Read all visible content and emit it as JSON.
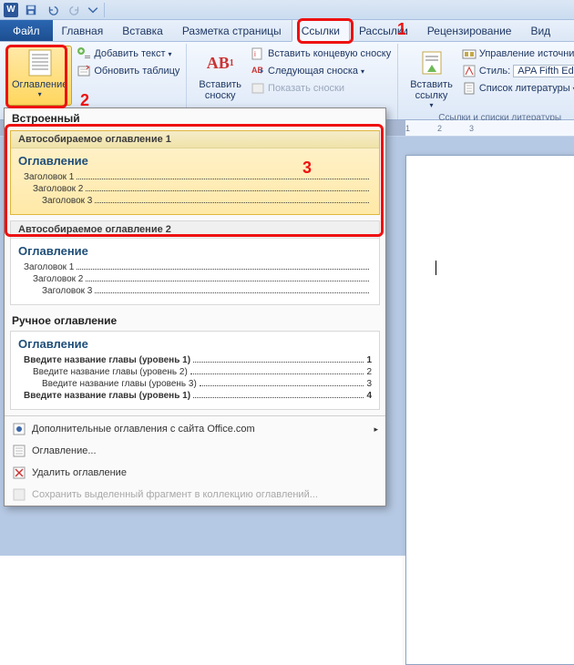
{
  "titlebar": {
    "word_letter": "W"
  },
  "tabs": {
    "file": "Файл",
    "items": [
      "Главная",
      "Вставка",
      "Разметка страницы",
      "Ссылки",
      "Рассылки",
      "Рецензирование",
      "Вид"
    ],
    "active_index": 3
  },
  "ribbon": {
    "toc": {
      "label": "Оглавление",
      "add_text": "Добавить текст",
      "update_table": "Обновить таблицу"
    },
    "footnotes": {
      "insert_big": "Вставить\nсноску",
      "big_badge": "AB",
      "big_badge_sup": "1",
      "insert_endnote": "Вставить концевую сноску",
      "next_footnote": "Следующая сноска",
      "show_notes": "Показать сноски"
    },
    "citations": {
      "insert_big": "Вставить\nссылку",
      "manage_sources": "Управление источникам",
      "style_label": "Стиль:",
      "style_value": "APA Fifth Editi",
      "bibliography": "Список литературы",
      "group_title": "Ссылки и списки литературы"
    }
  },
  "gallery": {
    "section_builtin": "Встроенный",
    "auto1_title": "Автособираемое оглавление 1",
    "auto2_title": "Автособираемое оглавление 2",
    "manual_title": "Ручное оглавление",
    "toc_word": "Оглавление",
    "auto_rows": [
      {
        "text": "Заголовок 1",
        "level": 1
      },
      {
        "text": "Заголовок 2",
        "level": 2
      },
      {
        "text": "Заголовок 3",
        "level": 3
      }
    ],
    "manual_rows": [
      {
        "text": "Введите название главы (уровень 1)",
        "page": "1",
        "level": 1,
        "bold": true
      },
      {
        "text": "Введите название главы (уровень 2)",
        "page": "2",
        "level": 2
      },
      {
        "text": "Введите название главы (уровень 3)",
        "page": "3",
        "level": 3
      },
      {
        "text": "Введите название главы (уровень 1)",
        "page": "4",
        "level": 1,
        "bold": true
      }
    ],
    "menu_office": "Дополнительные оглавления с сайта Office.com",
    "menu_custom": "Оглавление...",
    "menu_remove": "Удалить оглавление",
    "menu_save": "Сохранить выделенный фрагмент в коллекцию оглавлений..."
  },
  "ruler": {
    "ticks": [
      "1",
      "2",
      "3"
    ]
  },
  "callouts": {
    "n1": "1",
    "n2": "2",
    "n3": "3"
  }
}
